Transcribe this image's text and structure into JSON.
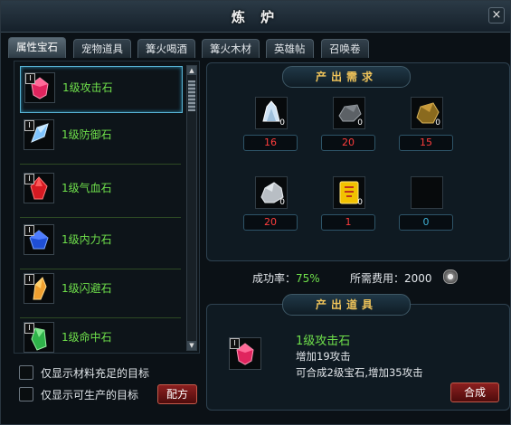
{
  "window": {
    "title": "炼 炉",
    "close_glyph": "×"
  },
  "tabs": [
    {
      "label": "属性宝石",
      "active": true
    },
    {
      "label": "宠物道具",
      "active": false
    },
    {
      "label": "篝火喝酒",
      "active": false
    },
    {
      "label": "篝火木材",
      "active": false
    },
    {
      "label": "英雄帖",
      "active": false
    },
    {
      "label": "召唤卷",
      "active": false
    }
  ],
  "items": [
    {
      "label": "1级攻击石",
      "badge": "I",
      "icon": "red-gem-icon",
      "selected": true
    },
    {
      "label": "1级防御石",
      "badge": "I",
      "icon": "blue-crystal-icon",
      "selected": false
    },
    {
      "label": "1级气血石",
      "badge": "I",
      "icon": "red-crystal-icon",
      "selected": false
    },
    {
      "label": "1级内力石",
      "badge": "I",
      "icon": "blue-orb-icon",
      "selected": false
    },
    {
      "label": "1级闪避石",
      "badge": "I",
      "icon": "orange-crystal-icon",
      "selected": false
    },
    {
      "label": "1级命中石",
      "badge": "I",
      "icon": "green-crystal-icon",
      "selected": false
    }
  ],
  "filters": [
    {
      "label": "仅显示材料充足的目标",
      "checked": false
    },
    {
      "label": "仅显示可生产的目标",
      "checked": false
    }
  ],
  "recipe_button": "配方",
  "requirements_header": "产出需求",
  "materials": [
    {
      "icon": "white-crystal-icon",
      "have": "0",
      "need": "16",
      "color": "#ff3d3d"
    },
    {
      "icon": "dark-ore-icon",
      "have": "0",
      "need": "20",
      "color": "#ff3d3d"
    },
    {
      "icon": "gold-ore-icon",
      "have": "0",
      "need": "15",
      "color": "#ff3d3d"
    },
    {
      "icon": "silver-ore-icon",
      "have": "0",
      "need": "20",
      "color": "#ff3d3d"
    },
    {
      "icon": "scroll-charm-icon",
      "have": "0",
      "need": "1",
      "color": "#ff3d3d"
    },
    {
      "icon": "empty-slot-icon",
      "have": "",
      "need": "0",
      "color": "#3fb2d6"
    }
  ],
  "stats": {
    "success_label": "成功率：",
    "success_value": "75%",
    "cost_label": "所需费用：",
    "cost_value": "2000",
    "coin_icon": "silver-coin-icon"
  },
  "output_header": "产出道具",
  "output": {
    "badge": "I",
    "icon": "red-gem-icon",
    "name": "1级攻击石",
    "line1": "增加19攻击",
    "line2": "可合成2级宝石,增加35攻击"
  },
  "compose_button": "合成",
  "colors": {
    "item_green": "#6fe04b",
    "need_red": "#ff3d3d",
    "header_gold": "#f0c45a"
  }
}
